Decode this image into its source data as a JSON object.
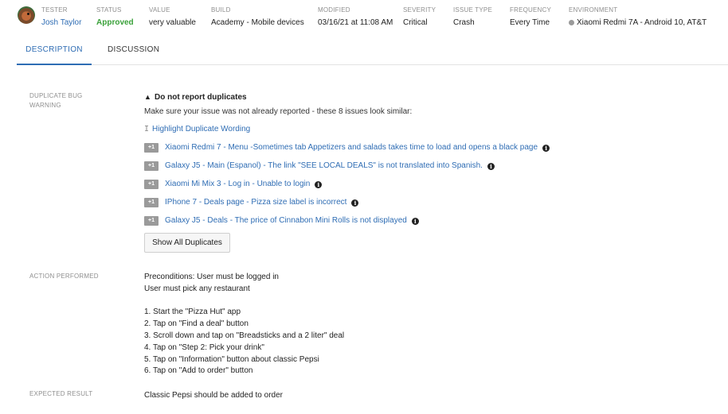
{
  "header": {
    "tester": {
      "label": "TESTER",
      "name": "Josh Taylor"
    },
    "status": {
      "label": "STATUS",
      "value": "Approved",
      "color": "#3aa13a"
    },
    "value": {
      "label": "VALUE",
      "value": "very valuable"
    },
    "build": {
      "label": "BUILD",
      "value": "Academy - Mobile devices"
    },
    "modified": {
      "label": "MODIFIED",
      "value": "03/16/21 at 11:08 AM"
    },
    "severity": {
      "label": "SEVERITY",
      "value": "Critical"
    },
    "issue_type": {
      "label": "ISSUE TYPE",
      "value": "Crash"
    },
    "frequency": {
      "label": "FREQUENCY",
      "value": "Every Time"
    },
    "environment": {
      "label": "ENVIRONMENT",
      "value": "Xiaomi Redmi 7A - Android 10, AT&T",
      "icon": "android-icon"
    }
  },
  "tabs": [
    {
      "label": "DESCRIPTION",
      "active": true
    },
    {
      "label": "DISCUSSION",
      "active": false
    }
  ],
  "duplicate": {
    "section_label_line1": "DUPLICATE BUG",
    "section_label_line2": "WARNING",
    "title": "Do not report duplicates",
    "title_icon": "warning-icon",
    "description": "Make sure your issue was not already reported - these 8 issues look similar:",
    "highlight_label": "Highlight Duplicate Wording",
    "plus_label": "+1",
    "items": [
      {
        "label": "Xiaomi Redmi 7 - Menu -Sometimes tab Appetizers and salads takes time to load and opens a black page"
      },
      {
        "label": "Galaxy J5 - Main (Espanol) - The link \"SEE LOCAL DEALS\" is not translated into Spanish."
      },
      {
        "label": "Xiaomi Mi Mix 3 - Log in - Unable to login"
      },
      {
        "label": "IPhone 7 - Deals page - Pizza size label is incorrect"
      },
      {
        "label": "Galaxy J5 - Deals - The price of Cinnabon Mini Rolls is not displayed"
      }
    ],
    "show_all_label": "Show All Duplicates"
  },
  "action": {
    "section_label": "ACTION PERFORMED",
    "text": "Preconditions: User must be logged in\nUser must pick any restaurant\n\n1. Start the \"Pizza Hut\" app\n2. Tap on \"Find a deal\" button\n3. Scroll down and tap on \"Breadsticks and a 2 liter\" deal\n4. Tap on \"Step 2: Pick your drink\"\n5. Tap on \"Information\" button about classic Pepsi\n6. Tap on \"Add to order\" button"
  },
  "expected": {
    "section_label": "EXPECTED RESULT",
    "text": "Classic Pepsi should be added to order"
  },
  "colors": {
    "link": "#2f6db4",
    "approved": "#3aa13a",
    "label": "#8f8f8f"
  }
}
